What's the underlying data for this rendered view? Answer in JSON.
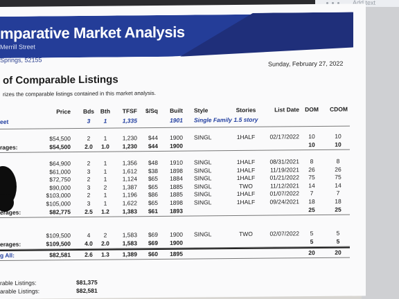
{
  "top_strip": {
    "label": "Add text"
  },
  "report": {
    "title": "mparative Market Analysis",
    "street": "Merrill Street",
    "city": "Springs, 52155",
    "date": "Sunday, February 27, 2022"
  },
  "section": {
    "title": "of Comparable Listings",
    "description": "rizes the comparable listings contained in this market analysis."
  },
  "table": {
    "columns": [
      "Price",
      "Bds",
      "Bth",
      "TFSF",
      "$/Sq",
      "Built",
      "Style",
      "Stories",
      "List Date",
      "DOM",
      "CDOM"
    ],
    "subject": {
      "label": "eet",
      "bds": "3",
      "bth": "1",
      "tfsf": "1,335",
      "built": "1901",
      "style": "Single Family",
      "stories": "1.5 story"
    },
    "groups": [
      {
        "rows": [
          {
            "price": "$54,500",
            "bds": "2",
            "bth": "1",
            "tfsf": "1,230",
            "sq": "$44",
            "built": "1900",
            "style": "SINGL",
            "stories": "1HALF",
            "list_date": "02/17/2022",
            "dom": "10",
            "cdom": "10"
          }
        ],
        "avg": {
          "label": "rages:",
          "price": "$54,500",
          "bds": "2.0",
          "bth": "1.0",
          "tfsf": "1,230",
          "sq": "$44",
          "built": "1900",
          "dom": "10",
          "cdom": "10"
        }
      },
      {
        "rows": [
          {
            "price": "$64,900",
            "bds": "2",
            "bth": "1",
            "tfsf": "1,356",
            "sq": "$48",
            "built": "1910",
            "style": "SINGL",
            "stories": "1HALF",
            "list_date": "08/31/2021",
            "dom": "8",
            "cdom": "8"
          },
          {
            "price": "$61,000",
            "bds": "3",
            "bth": "1",
            "tfsf": "1,612",
            "sq": "$38",
            "built": "1898",
            "style": "SINGL",
            "stories": "1HALF",
            "list_date": "11/19/2021",
            "dom": "26",
            "cdom": "26"
          },
          {
            "price": "$72,750",
            "bds": "2",
            "bth": "1",
            "tfsf": "1,124",
            "sq": "$65",
            "built": "1884",
            "style": "SINGL",
            "stories": "1HALF",
            "list_date": "01/21/2022",
            "dom": "75",
            "cdom": "75"
          },
          {
            "price": "$90,000",
            "bds": "3",
            "bth": "2",
            "tfsf": "1,387",
            "sq": "$65",
            "built": "1885",
            "style": "SINGL",
            "stories": "TWO",
            "list_date": "11/12/2021",
            "dom": "14",
            "cdom": "14"
          },
          {
            "price": "$103,000",
            "bds": "2",
            "bth": "1",
            "tfsf": "1,196",
            "sq": "$86",
            "built": "1885",
            "style": "SINGL",
            "stories": "1HALF",
            "list_date": "01/07/2022",
            "dom": "7",
            "cdom": "7"
          },
          {
            "price": "$105,000",
            "bds": "3",
            "bth": "1",
            "tfsf": "1,622",
            "sq": "$65",
            "built": "1898",
            "style": "SINGL",
            "stories": "1HALF",
            "list_date": "09/24/2021",
            "dom": "18",
            "cdom": "18"
          }
        ],
        "avg": {
          "label": "erages:",
          "price": "$82,775",
          "bds": "2.5",
          "bth": "1.2",
          "tfsf": "1,383",
          "sq": "$61",
          "built": "1893",
          "dom": "25",
          "cdom": "25"
        }
      },
      {
        "rows": [
          {
            "price": "$109,500",
            "bds": "4",
            "bth": "2",
            "tfsf": "1,583",
            "sq": "$69",
            "built": "1900",
            "style": "SINGL",
            "stories": "TWO",
            "list_date": "02/07/2022",
            "dom": "5",
            "cdom": "5"
          }
        ],
        "avg": {
          "label": "erages:",
          "price": "$109,500",
          "bds": "4.0",
          "bth": "2.0",
          "tfsf": "1,583",
          "sq": "$69",
          "built": "1900",
          "dom": "5",
          "cdom": "5"
        }
      }
    ],
    "overall": {
      "label": "g All:",
      "price": "$82,581",
      "bds": "2.6",
      "bth": "1.3",
      "tfsf": "1,389",
      "sq": "$60",
      "built": "1895",
      "dom": "20",
      "cdom": "20"
    }
  },
  "summary": [
    {
      "label": "rable Listings:",
      "value": "$81,375"
    },
    {
      "label": "arable Listings:",
      "value": "$82,581"
    }
  ],
  "colors": {
    "banner": "#243d98",
    "accent_text": "#213ea0"
  }
}
